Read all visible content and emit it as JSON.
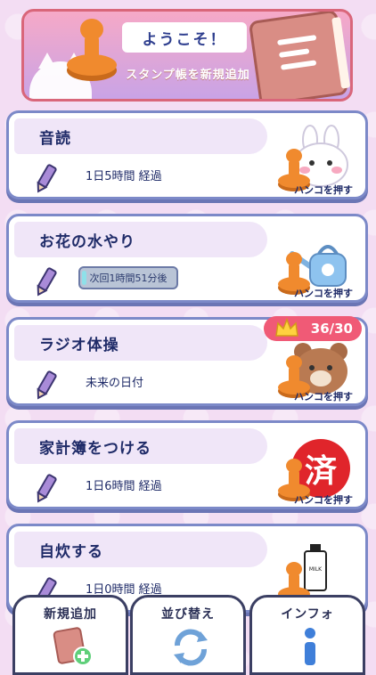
{
  "banner": {
    "welcome": "ようこそ！",
    "subtitle": "スタンプ帳を新規追加"
  },
  "cards": [
    {
      "title": "音読",
      "status": "1日5時間 経過",
      "icon": "rabbit-icon",
      "action": "ハンコを押す"
    },
    {
      "title": "お花の水やり",
      "status": "次回1時間51分後",
      "icon": "watering-can-icon",
      "action": "ハンコを押す"
    },
    {
      "title": "ラジオ体操",
      "status": "未来の日付",
      "icon": "bear-icon",
      "action": "ハンコを押す",
      "badge": "36/30"
    },
    {
      "title": "家計簿をつける",
      "status": "1日6時間 経過",
      "icon": "done-seal-icon",
      "stamp_text": "済",
      "action": "ハンコを押す"
    },
    {
      "title": "自炊する",
      "status": "1日0時間 経過",
      "icon": "milk-carton-icon",
      "milk_label": "MILK"
    }
  ],
  "bottom_nav": [
    {
      "label": "新規追加",
      "icon": "new-notebook-icon"
    },
    {
      "label": "並び替え",
      "icon": "sort-arrows-icon"
    },
    {
      "label": "インフォ",
      "icon": "info-icon"
    }
  ],
  "colors": {
    "card_border": "#7c89c8",
    "title_text": "#1f2b68",
    "stamp": "#e9822a",
    "badge": "#f05a76",
    "done_seal": "#e0252b"
  }
}
